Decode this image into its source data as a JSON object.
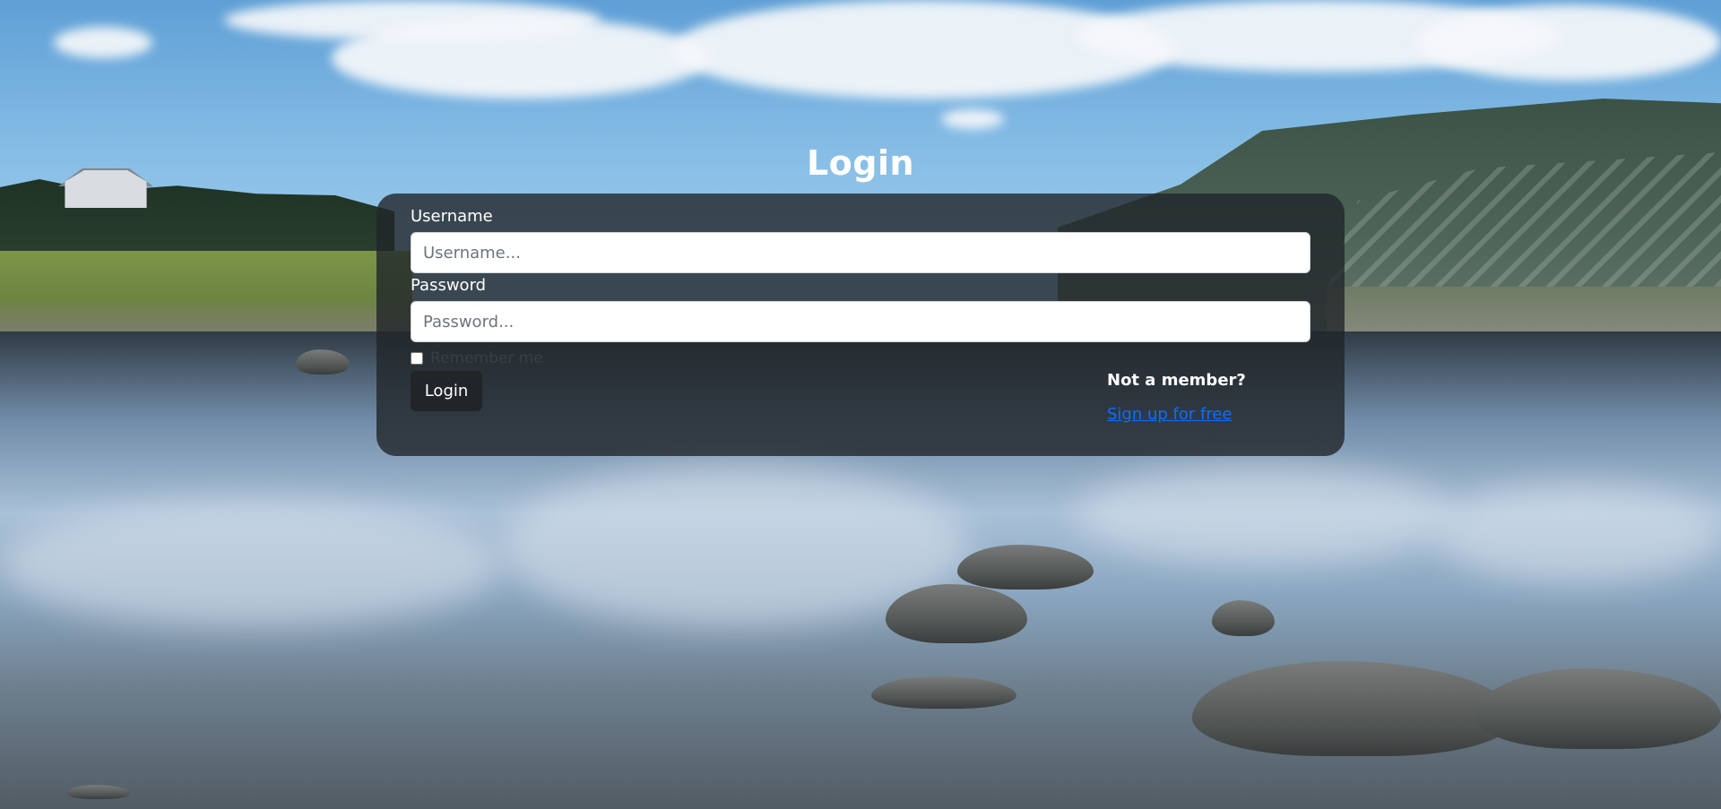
{
  "login": {
    "title": "Login",
    "username_label": "Username",
    "username_value": "",
    "username_placeholder": "Username...",
    "password_label": "Password",
    "password_value": "",
    "password_placeholder": "Password...",
    "remember_label": "Remember me",
    "remember_checked": false,
    "submit_label": "Login"
  },
  "signup": {
    "prompt": "Not a member?",
    "link_label": "Sign up for free"
  },
  "colors": {
    "card_background": "#212529",
    "link": "#0d6efd",
    "title_text": "#ffffff"
  }
}
